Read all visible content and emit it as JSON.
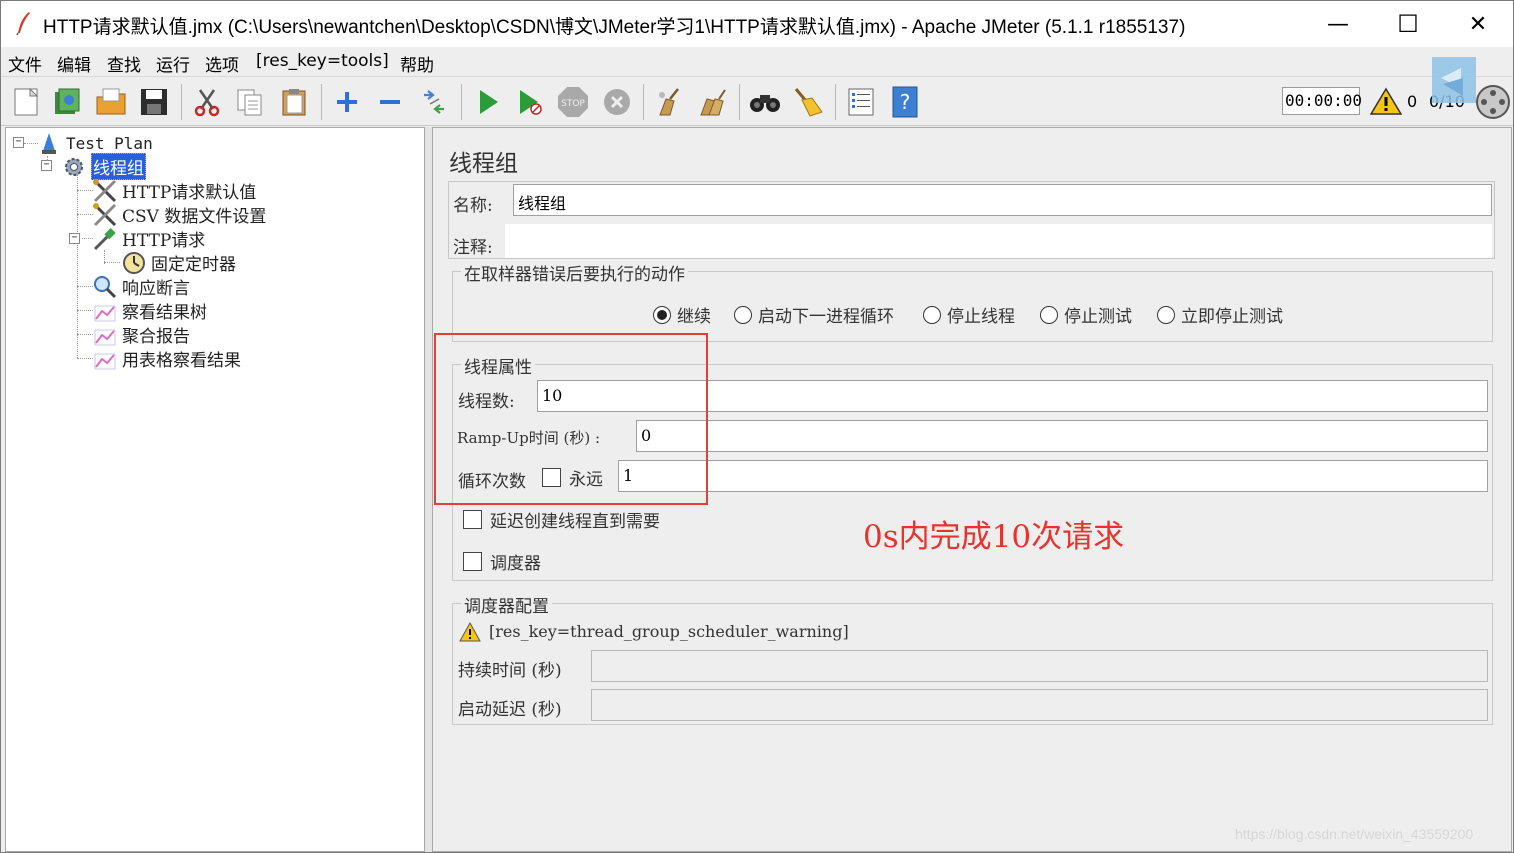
{
  "window": {
    "title": "HTTP请求默认值.jmx (C:\\Users\\newantchen\\Desktop\\CSDN\\博文\\JMeter学习1\\HTTP请求默认值.jmx) - Apache JMeter (5.1.1 r1855137)",
    "minimize": "—",
    "maximize": "☐",
    "close": "✕"
  },
  "menu": [
    "文件",
    "编辑",
    "查找",
    "运行",
    "选项",
    "[res_key=tools]",
    "帮助"
  ],
  "toolbar": {
    "timer": "00:00:00",
    "warning_count": "0",
    "threads": "0/10"
  },
  "tree": {
    "root": "Test Plan",
    "thread_group": "线程组",
    "items": [
      "HTTP请求默认值",
      "CSV 数据文件设置",
      "HTTP请求",
      "固定定时器",
      "响应断言",
      "察看结果树",
      "聚合报告",
      "用表格察看结果"
    ]
  },
  "panel": {
    "title": "线程组",
    "name_label": "名称:",
    "name_value": "线程组",
    "comment_label": "注释:",
    "comment_value": "",
    "error_action": {
      "title": "在取样器错误后要执行的动作",
      "options": [
        "继续",
        "启动下一进程循环",
        "停止线程",
        "停止测试",
        "立即停止测试"
      ],
      "selected": "继续"
    },
    "thread_props": {
      "title": "线程属性",
      "threads_label": "线程数:",
      "threads_value": "10",
      "rampup_label": "Ramp-Up时间 (秒) :",
      "rampup_value": "0",
      "loop_label": "循环次数",
      "forever_label": "永远",
      "loop_value": "1",
      "delay_label": "延迟创建线程直到需要",
      "scheduler_label": "调度器"
    },
    "scheduler": {
      "title": "调度器配置",
      "warning": "[res_key=thread_group_scheduler_warning]",
      "duration_label": "持续时间 (秒)",
      "duration_value": "",
      "startup_label": "启动延迟 (秒)",
      "startup_value": ""
    }
  },
  "annotation": "0s内完成10次请求",
  "watermark": "https://blog.csdn.net/weixin_43559200",
  "colors": {
    "selection": "#2b5fd9",
    "annotation": "#e8332d",
    "run_green": "#2c9b3a"
  }
}
